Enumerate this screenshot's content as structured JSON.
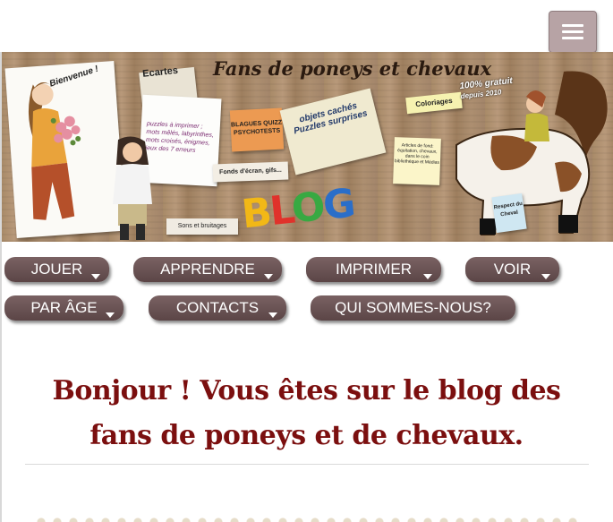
{
  "header": {
    "menu_icon": "hamburger-menu-icon",
    "menu_color": "#b7a3a5"
  },
  "banner": {
    "title": "Fans de poneys et chevaux",
    "welcome": "Bienvenue !",
    "ecartes": "Ecartes",
    "puzzle_note": "puzzles à imprimer ; mots mêlés, labyrinthes, mots croisés, énigmes, jeux des 7 erreurs",
    "blagues": "BLAGUES QUIZZ PSYCHOTESTS",
    "envelope": "objets cachés Puzzles surprises",
    "coloriages": "Coloriages",
    "free_line1": "100% gratuit",
    "free_line2": "depuis 2010",
    "fonds": "Fonds d'écran, gifs...",
    "sons": "Sons et bruitages",
    "articles": "Articles de fond: équitation, chevaux, dans le coin bibliothèque et Médias",
    "respect": "Respect du Cheval",
    "blog_b": "B",
    "blog_l": "L",
    "blog_o": "O",
    "blog_g": "G"
  },
  "nav": {
    "jouer": "JOUER",
    "apprendre": "APPRENDRE",
    "imprimer": "IMPRIMER",
    "voir": "VOIR",
    "par_age": "PAR ÂGE",
    "contacts": "CONTACTS",
    "qui_sommes_nous": "QUI SOMMES-NOUS?",
    "button_color": "#6b5354"
  },
  "main": {
    "headline": "Bonjour ! Vous êtes sur le blog des fans de poneys et de chevaux.",
    "headline_color": "#7b0f0f"
  }
}
